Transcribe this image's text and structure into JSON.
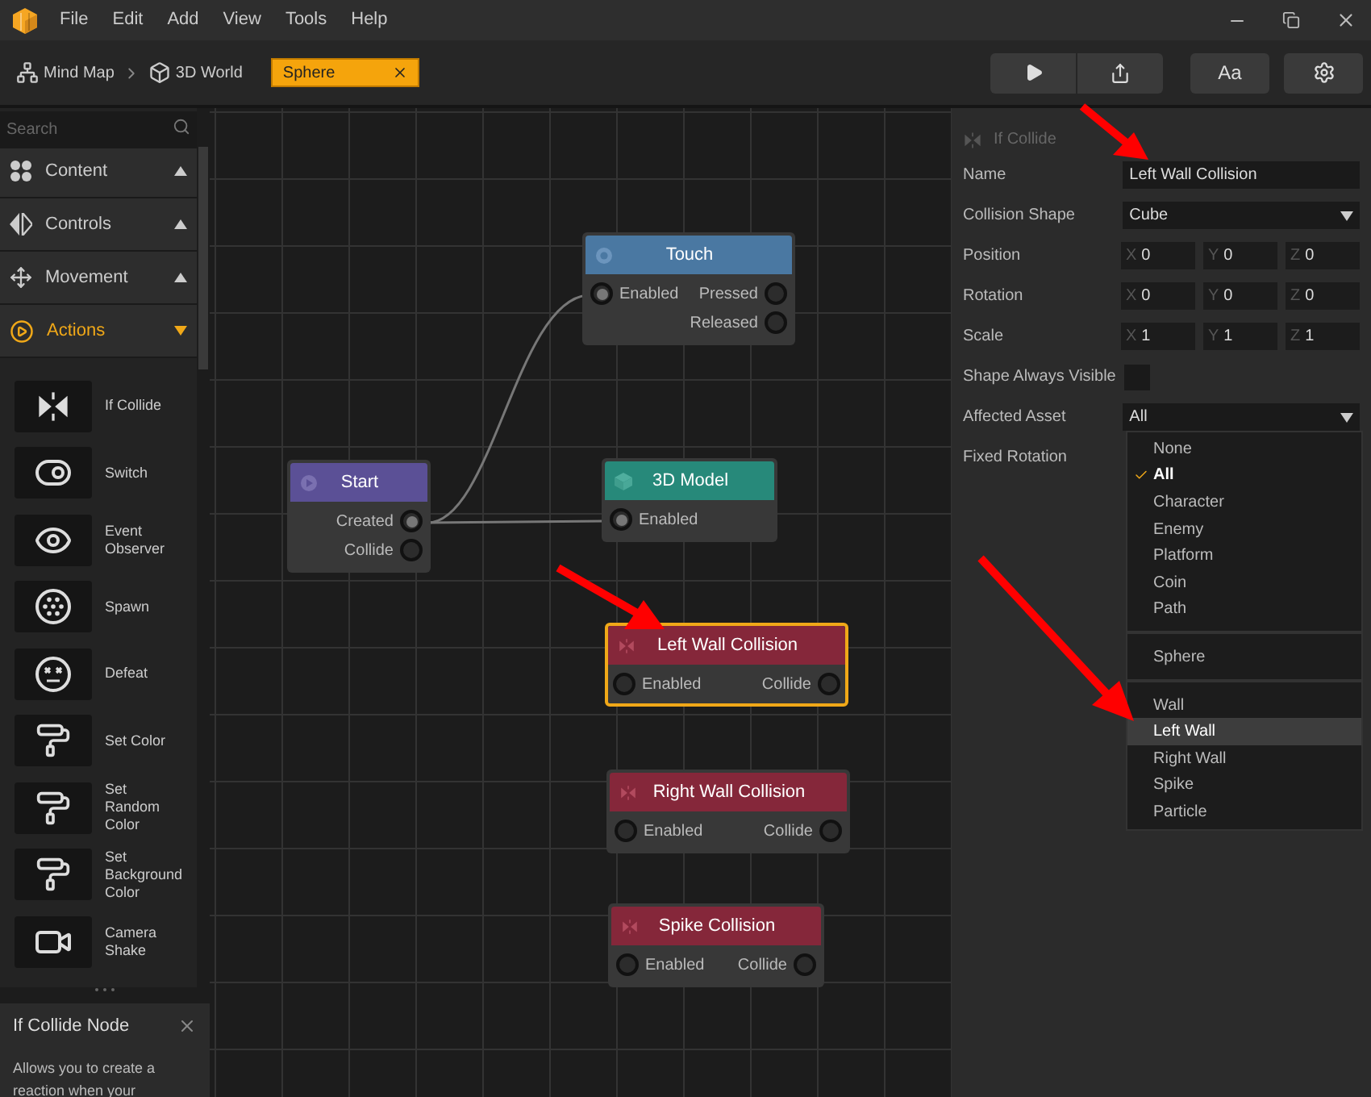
{
  "menu": [
    "File",
    "Edit",
    "Add",
    "View",
    "Tools",
    "Help"
  ],
  "breadcrumbs": [
    {
      "label": "Mind Map",
      "kind": "map"
    },
    {
      "label": "3D World",
      "kind": "world"
    }
  ],
  "active_tab": {
    "label": "Sphere"
  },
  "toolbar": {
    "font_button": "Aa"
  },
  "sidebar": {
    "search": {
      "placeholder": "Search"
    },
    "categories": [
      {
        "label": "Content",
        "expanded": false
      },
      {
        "label": "Controls",
        "expanded": false
      },
      {
        "label": "Movement",
        "expanded": false
      },
      {
        "label": "Actions",
        "expanded": true
      }
    ],
    "items": [
      "If Collide",
      "Switch",
      "Event Observer",
      "Spawn",
      "Defeat",
      "Set Color",
      "Set Random Color",
      "Set Background Color",
      "Camera Shake"
    ],
    "info": {
      "title": "If Collide Node",
      "text": "Allows you to create a reaction when your"
    }
  },
  "nodes": [
    {
      "title": "Touch",
      "color": "#4a78a2",
      "selected": false,
      "inputs": [
        {
          "label": "Enabled",
          "connected": true
        }
      ],
      "outputs": [
        {
          "label": "Pressed",
          "connected": false
        },
        {
          "label": "Released",
          "connected": false
        }
      ]
    },
    {
      "title": "Start",
      "color": "#5b5096",
      "selected": false,
      "outputs": [
        {
          "label": "Created",
          "connected": true
        },
        {
          "label": "Collide",
          "connected": false
        }
      ]
    },
    {
      "title": "3D Model",
      "color": "#27897a",
      "selected": false,
      "inputs": [
        {
          "label": "Enabled",
          "connected": true
        }
      ]
    },
    {
      "title": "Left Wall Collision",
      "color": "#85273a",
      "selected": true,
      "inputs": [
        {
          "label": "Enabled",
          "connected": false
        }
      ],
      "outputs": [
        {
          "label": "Collide",
          "connected": false
        }
      ]
    },
    {
      "title": "Right Wall Collision",
      "color": "#85273a",
      "selected": false,
      "inputs": [
        {
          "label": "Enabled",
          "connected": false
        }
      ],
      "outputs": [
        {
          "label": "Collide",
          "connected": false
        }
      ]
    },
    {
      "title": "Spike Collision",
      "color": "#85273a",
      "selected": false,
      "inputs": [
        {
          "label": "Enabled",
          "connected": false
        }
      ],
      "outputs": [
        {
          "label": "Collide",
          "connected": false
        }
      ]
    }
  ],
  "inspector": {
    "title": "If Collide",
    "properties": [
      {
        "label": "Name",
        "kind": "text",
        "value": "Left Wall Collision"
      },
      {
        "label": "Collision Shape",
        "kind": "select",
        "value": "Cube"
      },
      {
        "label": "Position",
        "kind": "vector",
        "values": [
          {
            "axis": "X",
            "value": "0"
          },
          {
            "axis": "Y",
            "value": "0"
          },
          {
            "axis": "Z",
            "value": "0"
          }
        ]
      },
      {
        "label": "Rotation",
        "kind": "vector",
        "values": [
          {
            "axis": "X",
            "value": "0"
          },
          {
            "axis": "Y",
            "value": "0"
          },
          {
            "axis": "Z",
            "value": "0"
          }
        ]
      },
      {
        "label": "Scale",
        "kind": "vector",
        "values": [
          {
            "axis": "X",
            "value": "1"
          },
          {
            "axis": "Y",
            "value": "1"
          },
          {
            "axis": "Z",
            "value": "1"
          }
        ]
      },
      {
        "label": "Shape Always Visible",
        "kind": "checkbox",
        "checked": false
      },
      {
        "label": "Affected Asset",
        "kind": "select",
        "value": "All"
      },
      {
        "label": "Fixed Rotation",
        "kind": "none"
      }
    ],
    "dropdown": {
      "groups": [
        [
          {
            "label": "None",
            "checked": false,
            "hovered": false
          },
          {
            "label": "All",
            "checked": true,
            "hovered": false
          },
          {
            "label": "Character",
            "checked": false,
            "hovered": false
          },
          {
            "label": "Enemy",
            "checked": false,
            "hovered": false
          },
          {
            "label": "Platform",
            "checked": false,
            "hovered": false
          },
          {
            "label": "Coin",
            "checked": false,
            "hovered": false
          },
          {
            "label": "Path",
            "checked": false,
            "hovered": false
          }
        ],
        [
          {
            "label": "Sphere",
            "checked": false,
            "hovered": false
          }
        ],
        [
          {
            "label": "Wall",
            "checked": false,
            "hovered": false
          },
          {
            "label": "Left Wall",
            "checked": false,
            "hovered": true
          },
          {
            "label": "Right Wall",
            "checked": false,
            "hovered": false
          },
          {
            "label": "Spike",
            "checked": false,
            "hovered": false
          },
          {
            "label": "Particle",
            "checked": false,
            "hovered": false
          }
        ]
      ]
    }
  }
}
